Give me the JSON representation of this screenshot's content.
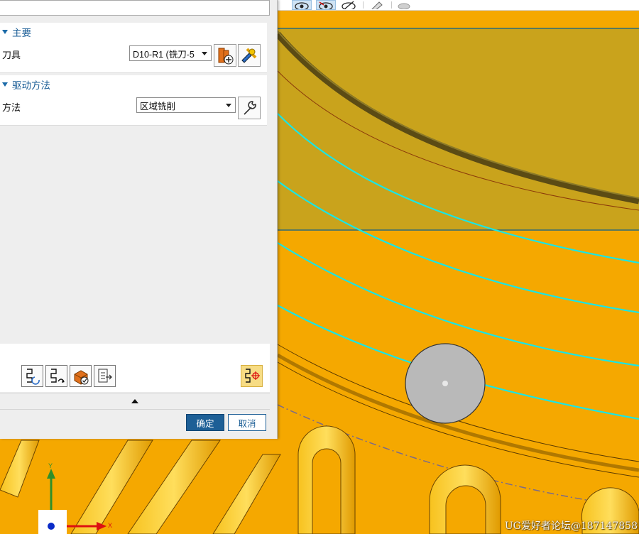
{
  "panel": {
    "main_group": {
      "title": "主要",
      "tool_label": "刀具",
      "tool_value": "D10-R1 (铣刀-5"
    },
    "drive_group": {
      "title": "驱动方法",
      "method_label": "方法",
      "method_value": "区域铣削"
    },
    "buttons": {
      "ok": "确定",
      "cancel": "取消"
    }
  },
  "viewport": {
    "axis_y": "Y",
    "axis_x": "X",
    "watermark": "UG爱好者论坛@187147858"
  },
  "colors": {
    "accent": "#1d5f96",
    "surface_orange": "#f5a800",
    "surface_olive": "#c9a31c",
    "toolpath": "#19e6e6"
  }
}
